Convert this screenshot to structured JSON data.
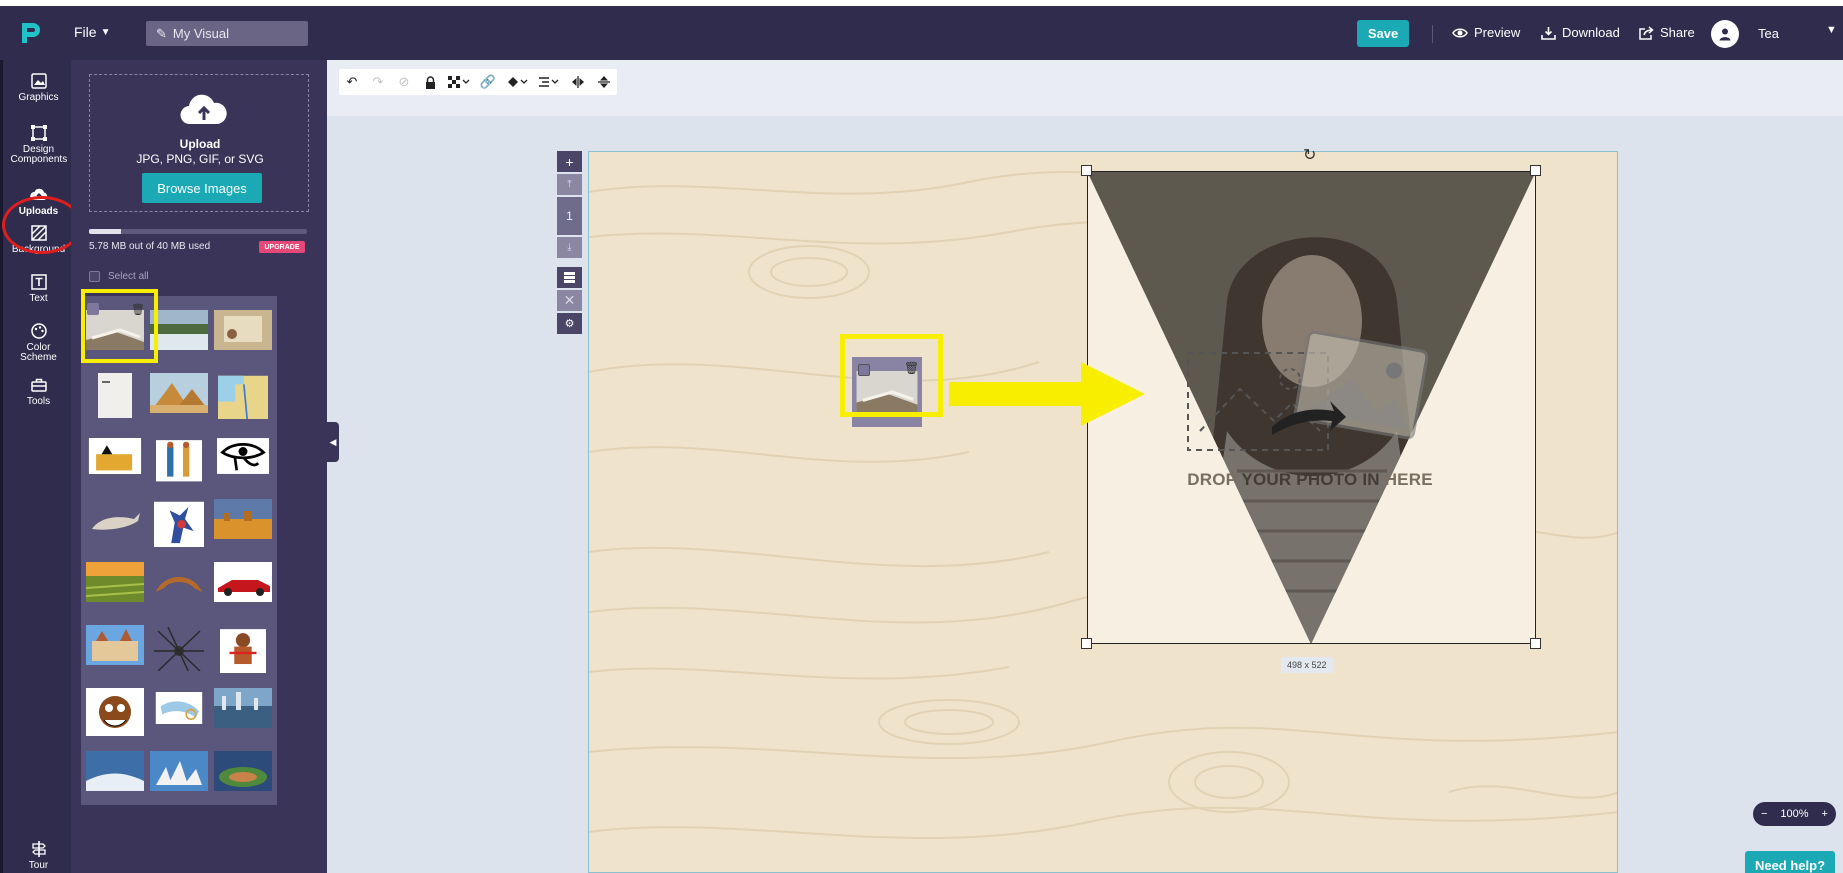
{
  "topbar": {
    "file_label": "File",
    "title_value": "My Visual",
    "save_label": "Save",
    "preview_label": "Preview",
    "download_label": "Download",
    "share_label": "Share",
    "user_name": "Tea"
  },
  "rail": {
    "items": [
      {
        "label": "Graphics",
        "icon": "graphics-icon"
      },
      {
        "label": "Design Components",
        "icon": "design-components-icon"
      },
      {
        "label": "Uploads",
        "icon": "upload-cloud-icon",
        "active": true
      },
      {
        "label": "Background",
        "icon": "background-icon"
      },
      {
        "label": "Text",
        "icon": "text-icon"
      },
      {
        "label": "Color Scheme",
        "icon": "palette-icon"
      },
      {
        "label": "Tools",
        "icon": "toolbox-icon"
      }
    ],
    "tour_label": "Tour"
  },
  "uploads": {
    "title": "Upload",
    "formats": "JPG, PNG, GIF, or SVG",
    "browse_label": "Browse Images",
    "storage_text": "5.78 MB out of 40 MB used",
    "storage_fraction": 0.1445,
    "upgrade_label": "UPGRADE",
    "select_all_label": "Select all"
  },
  "toolbar": {
    "tools": [
      "undo-icon",
      "redo-icon",
      "stop-icon",
      "lock-icon",
      "transparency-icon",
      "link-icon",
      "fill-icon",
      "align-icon",
      "flip-horizontal-icon",
      "flip-vertical-icon"
    ]
  },
  "pagenav": {
    "page_number": "1"
  },
  "canvas": {
    "drop_text_prefix": "DROP ",
    "drop_text_bold": "YOUR PHOTO IN",
    "drop_text_suffix": " HERE",
    "size_label": "498 x 522"
  },
  "zoom": {
    "level": "100%",
    "minus": "−",
    "plus": "+"
  },
  "help_label": "Need help?",
  "colors": {
    "accent": "#1aa9b5",
    "bar": "#2f2c4d",
    "panel": "#3a3558",
    "highlight": "#f8ef00",
    "callout": "#e01e1e",
    "upgrade": "#e54778"
  }
}
